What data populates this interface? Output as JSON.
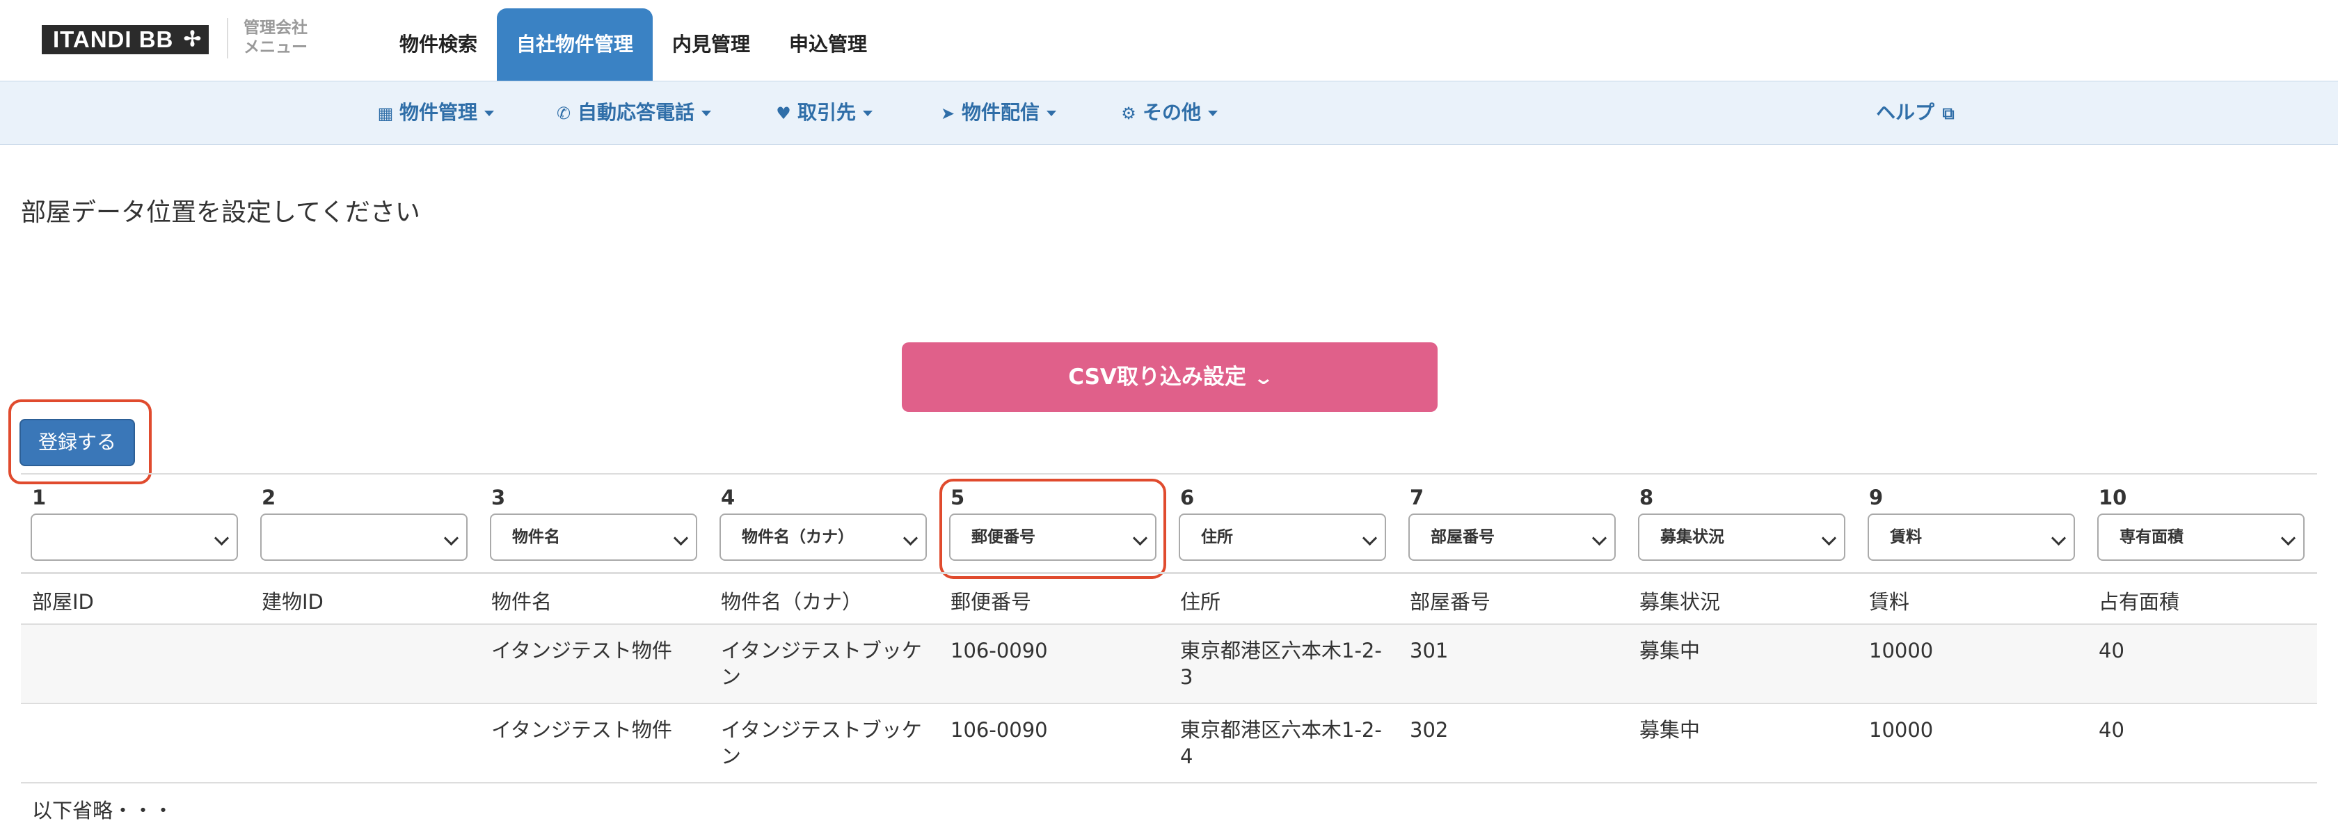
{
  "brand": {
    "logo_text": "ITANDI BB",
    "logo_mark": "✢",
    "company_menu": "管理会社\nメニュー"
  },
  "main_nav": {
    "tabs": [
      {
        "label": "物件検索",
        "active": false
      },
      {
        "label": "自社物件管理",
        "active": true
      },
      {
        "label": "内見管理",
        "active": false
      },
      {
        "label": "申込管理",
        "active": false
      }
    ]
  },
  "sub_nav": {
    "items": [
      {
        "label": "物件管理",
        "icon": "building-icon"
      },
      {
        "label": "自動応答電話",
        "icon": "phone-icon"
      },
      {
        "label": "取引先",
        "icon": "heartbeat-icon"
      },
      {
        "label": "物件配信",
        "icon": "paper-plane-icon"
      },
      {
        "label": "その他",
        "icon": "gear-icon"
      }
    ],
    "help_label": "ヘルプ",
    "help_icon": "external-link-icon"
  },
  "page_title": "部屋データ位置を設定してください",
  "csv_button_label": "CSV取り込み設定",
  "register_button_label": "登録する",
  "columns": [
    {
      "number": "1",
      "selected": ""
    },
    {
      "number": "2",
      "selected": ""
    },
    {
      "number": "3",
      "selected": "物件名"
    },
    {
      "number": "4",
      "selected": "物件名（カナ）"
    },
    {
      "number": "5",
      "selected": "郵便番号"
    },
    {
      "number": "6",
      "selected": "住所"
    },
    {
      "number": "7",
      "selected": "部屋番号"
    },
    {
      "number": "8",
      "selected": "募集状況"
    },
    {
      "number": "9",
      "selected": "賃料"
    },
    {
      "number": "10",
      "selected": "専有面積"
    }
  ],
  "table": {
    "headers": [
      "部屋ID",
      "建物ID",
      "物件名",
      "物件名（カナ）",
      "郵便番号",
      "住所",
      "部屋番号",
      "募集状況",
      "賃料",
      "占有面積"
    ],
    "rows": [
      [
        "",
        "",
        "イタンジテスト物件",
        "イタンジテストブッケン",
        "106-0090",
        "東京都港区六本木1-2-3",
        "301",
        "募集中",
        "10000",
        "40"
      ],
      [
        "",
        "",
        "イタンジテスト物件",
        "イタンジテストブッケン",
        "106-0090",
        "東京都港区六本木1-2-4",
        "302",
        "募集中",
        "10000",
        "40"
      ]
    ]
  },
  "footer_note": "以下省略・・・",
  "colors": {
    "accent_blue": "#3a82c4",
    "csv_pink": "#e0608a",
    "highlight_red": "#e04b2e",
    "subnav_bg": "#eaf2fa"
  }
}
